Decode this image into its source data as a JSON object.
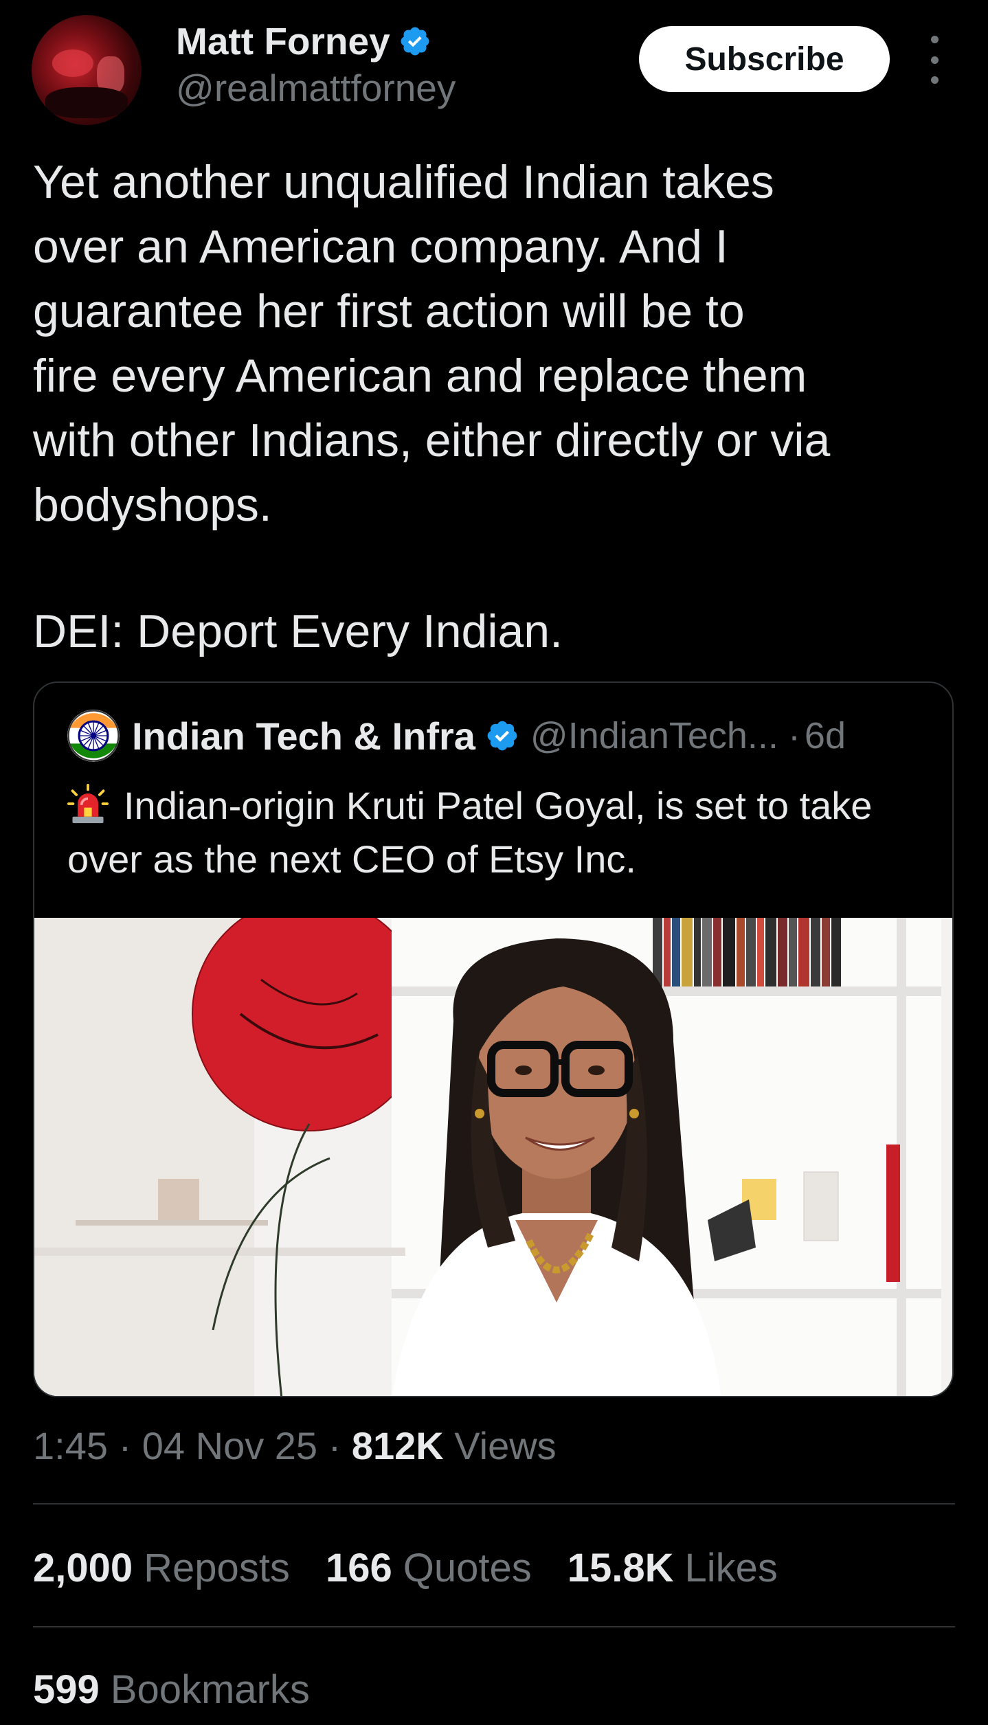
{
  "author": {
    "display_name": "Matt Forney",
    "handle": "@realmattforney",
    "verified_icon": "verified-badge-icon",
    "avatar_icon": "avatar"
  },
  "header": {
    "subscribe_label": "Subscribe",
    "more_icon": "more-options-icon"
  },
  "tweet": {
    "text": "Yet another unqualified Indian takes\nover an American company. And I\nguarantee her first action will be to\nfire every American and replace them\nwith other Indians, either directly or via\nbodyshops.",
    "text2": "DEI: Deport Every Indian."
  },
  "quote": {
    "avatar_icon": "ashoka-chakra-avatar",
    "display_name": "Indian Tech & Infra",
    "handle": "@IndianTech...",
    "separator": "·",
    "age": "6d",
    "siren_icon": "siren-emoji-icon",
    "text": "Indian-origin Kruti Patel Goyal, is set to take over as the next CEO of Etsy Inc.",
    "image_icon": "photo-portrait"
  },
  "meta": {
    "time": "1:45",
    "sep1": "·",
    "date": "04 Nov 25",
    "sep2": "·",
    "views_count": "812K",
    "views_label": "Views"
  },
  "stats": {
    "reposts_count": "2,000",
    "reposts_label": "Reposts",
    "quotes_count": "166",
    "quotes_label": "Quotes",
    "likes_count": "15.8K",
    "likes_label": "Likes",
    "bookmarks_count": "599",
    "bookmarks_label": "Bookmarks"
  },
  "colors": {
    "background": "#000000",
    "text_primary": "#e7e9ea",
    "text_secondary": "#71767b",
    "verified_blue": "#1d9bf0",
    "divider": "#2f3336"
  }
}
